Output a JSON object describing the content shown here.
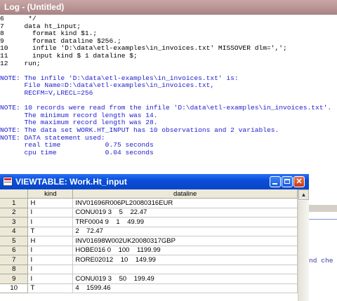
{
  "log": {
    "title": "Log - (Untitled)",
    "lines": [
      {
        "text": "6      */",
        "tone": "black"
      },
      {
        "text": "7     data ht_input;",
        "tone": "black"
      },
      {
        "text": "8       format kind $1.;",
        "tone": "black"
      },
      {
        "text": "9       format dataline $256.;",
        "tone": "black"
      },
      {
        "text": "10      infile 'D:\\data\\etl-examples\\in_invoices.txt' MISSOVER dlm=',';",
        "tone": "black"
      },
      {
        "text": "11      input kind $ 1 dataline $;",
        "tone": "black"
      },
      {
        "text": "12    run;",
        "tone": "black"
      },
      {
        "text": "",
        "tone": "black"
      },
      {
        "text": "NOTE: The infile 'D:\\data\\etl-examples\\in_invoices.txt' is:",
        "tone": "blue"
      },
      {
        "text": "      File Name=D:\\data\\etl-examples\\in_invoices.txt,",
        "tone": "blue"
      },
      {
        "text": "      RECFM=V,LRECL=256",
        "tone": "blue"
      },
      {
        "text": "",
        "tone": "black"
      },
      {
        "text": "NOTE: 10 records were read from the infile 'D:\\data\\etl-examples\\in_invoices.txt'.",
        "tone": "blue"
      },
      {
        "text": "      The minimum record length was 14.",
        "tone": "blue"
      },
      {
        "text": "      The maximum record length was 28.",
        "tone": "blue"
      },
      {
        "text": "NOTE: The data set WORK.HT_INPUT has 10 observations and 2 variables.",
        "tone": "blue"
      },
      {
        "text": "NOTE: DATA statement used:",
        "tone": "blue"
      },
      {
        "text": "      real time           0.75 seconds",
        "tone": "blue"
      },
      {
        "text": "      cpu time            0.04 seconds",
        "tone": "blue"
      }
    ],
    "partial_right_text": "nd che"
  },
  "viewtable": {
    "title": "VIEWTABLE: Work.Ht_input",
    "columns": [
      "kind",
      "dataline"
    ],
    "rows": [
      {
        "num": "1",
        "kind": "H",
        "dataline": "INV01696R006PL20080316EUR"
      },
      {
        "num": "2",
        "kind": "I",
        "dataline": "CONU019 3    5    22.47"
      },
      {
        "num": "3",
        "kind": "I",
        "dataline": "TRF0004 9    1    49.99"
      },
      {
        "num": "4",
        "kind": "T",
        "dataline": "2    72.47"
      },
      {
        "num": "5",
        "kind": "H",
        "dataline": "INV01698W002UK20080317GBP"
      },
      {
        "num": "6",
        "kind": "I",
        "dataline": "HOBE016 0    100    1199.99"
      },
      {
        "num": "7",
        "kind": "I",
        "dataline": "RORE02012    10    149.99"
      },
      {
        "num": "8",
        "kind": "I",
        "dataline": ""
      },
      {
        "num": "9",
        "kind": "I",
        "dataline": "CONU019 3    50    199.49"
      },
      {
        "num": "10",
        "kind": "T",
        "dataline": "4    1599.46"
      }
    ],
    "selected_row": "10",
    "buttons": {
      "minimize": "minimize",
      "maximize": "maximize",
      "close": "✕"
    }
  },
  "colors": {
    "log_note_text": "#1f1fcf",
    "viewtable_titlebar": "#0a4fd8",
    "log_titlebar": "#a88383"
  },
  "icons": {
    "viewtable": "table-window-icon",
    "scroll_up": "scroll-up-arrow-icon"
  }
}
